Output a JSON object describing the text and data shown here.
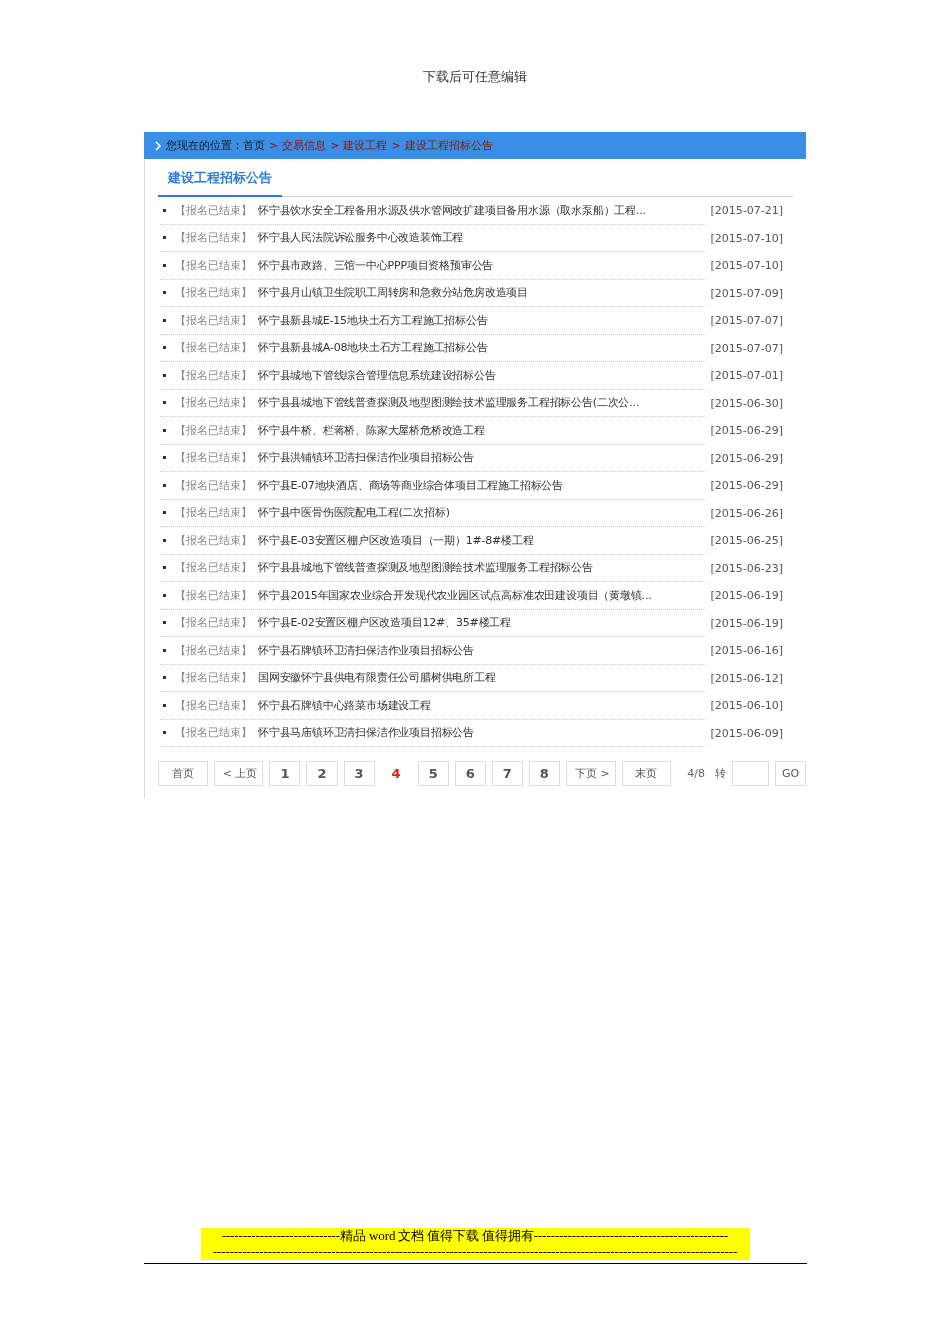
{
  "doc_header": "下载后可任意编辑",
  "breadcrumb": {
    "label": "您现在的位置：首页",
    "separator": ">",
    "links": [
      "交易信息",
      "建设工程",
      "建设工程招标公告"
    ]
  },
  "tab": {
    "label": "建设工程招标公告",
    "selected": true
  },
  "rows": [
    {
      "status": "【报名已结束】",
      "title": "怀宁县饮水安全工程备用水源及供水管网改扩建项目备用水源（取水泵船）工程...",
      "date": "[2015-07-21]"
    },
    {
      "status": "【报名已结束】",
      "title": "怀宁县人民法院诉讼服务中心改造装饰工程",
      "date": "[2015-07-10]"
    },
    {
      "status": "【报名已结束】",
      "title": "怀宁县市政路、三馆一中心PPP项目资格预审公告",
      "date": "[2015-07-10]"
    },
    {
      "status": "【报名已结束】",
      "title": "怀宁县月山镇卫生院职工周转房和急救分站危房改造项目",
      "date": "[2015-07-09]"
    },
    {
      "status": "【报名已结束】",
      "title": "怀宁县新县城E-15地块土石方工程施工招标公告",
      "date": "[2015-07-07]"
    },
    {
      "status": "【报名已结束】",
      "title": "怀宁县新县城A-08地块土石方工程施工招标公告",
      "date": "[2015-07-07]"
    },
    {
      "status": "【报名已结束】",
      "title": "怀宁县城地下管线综合管理信息系统建设招标公告",
      "date": "[2015-07-01]"
    },
    {
      "status": "【报名已结束】",
      "title": "怀宁县县城地下管线普查探测及地型图测绘技术监理服务工程招标公告(二次公...",
      "date": "[2015-06-30]"
    },
    {
      "status": "【报名已结束】",
      "title": "怀宁县牛桥、栏蒋桥、陈家大屋桥危桥改造工程",
      "date": "[2015-06-29]"
    },
    {
      "status": "【报名已结束】",
      "title": "怀宁县洪铺镇环卫清扫保洁作业项目招标公告",
      "date": "[2015-06-29]"
    },
    {
      "status": "【报名已结束】",
      "title": "怀宁县E-07地块酒店、商场等商业综合体项目工程施工招标公告",
      "date": "[2015-06-29]"
    },
    {
      "status": "【报名已结束】",
      "title": "怀宁县中医骨伤医院配电工程(二次招标)",
      "date": "[2015-06-26]"
    },
    {
      "status": "【报名已结束】",
      "title": "怀宁县E-03安置区棚户区改造项目（一期）1#-8#楼工程",
      "date": "[2015-06-25]"
    },
    {
      "status": "【报名已结束】",
      "title": "怀宁县县城地下管线普查探测及地型图测绘技术监理服务工程招标公告",
      "date": "[2015-06-23]"
    },
    {
      "status": "【报名已结束】",
      "title": "怀宁县2015年国家农业综合开发现代农业园区试点高标准农田建设项目（黄墩镇...",
      "date": "[2015-06-19]"
    },
    {
      "status": "【报名已结束】",
      "title": "怀宁县E-02安置区棚户区改造项目12#、35#楼工程",
      "date": "[2015-06-19]"
    },
    {
      "status": "【报名已结束】",
      "title": "怀宁县石牌镇环卫清扫保洁作业项目招标公告",
      "date": "[2015-06-16]"
    },
    {
      "status": "【报名已结束】",
      "title": "国网安徽怀宁县供电有限责任公司腊树供电所工程",
      "date": "[2015-06-12]"
    },
    {
      "status": "【报名已结束】",
      "title": "怀宁县石牌镇中心路菜市场建设工程",
      "date": "[2015-06-10]"
    },
    {
      "status": "【报名已结束】",
      "title": "怀宁县马庙镇环卫清扫保洁作业项目招标公告",
      "date": "[2015-06-09]"
    }
  ],
  "pagination": {
    "first": "首页",
    "prev": "< 上页",
    "pages": [
      {
        "label": "1",
        "selected": false
      },
      {
        "label": "2",
        "selected": false
      },
      {
        "label": "3",
        "selected": false
      },
      {
        "label": "4",
        "selected": true
      },
      {
        "label": "5",
        "selected": false
      },
      {
        "label": "6",
        "selected": false
      },
      {
        "label": "7",
        "selected": false
      },
      {
        "label": "8",
        "selected": false
      }
    ],
    "next": "下页 >",
    "last": "末页",
    "page_info": "4/8",
    "goto_label": "转",
    "go": "GO"
  },
  "doc_footer": {
    "line_1": "----------------------------精品 word 文档  值得下载  值得拥有----------------------------------------------",
    "line_2": "----------------------------------------------------------------------------------------------------------------------------"
  }
}
